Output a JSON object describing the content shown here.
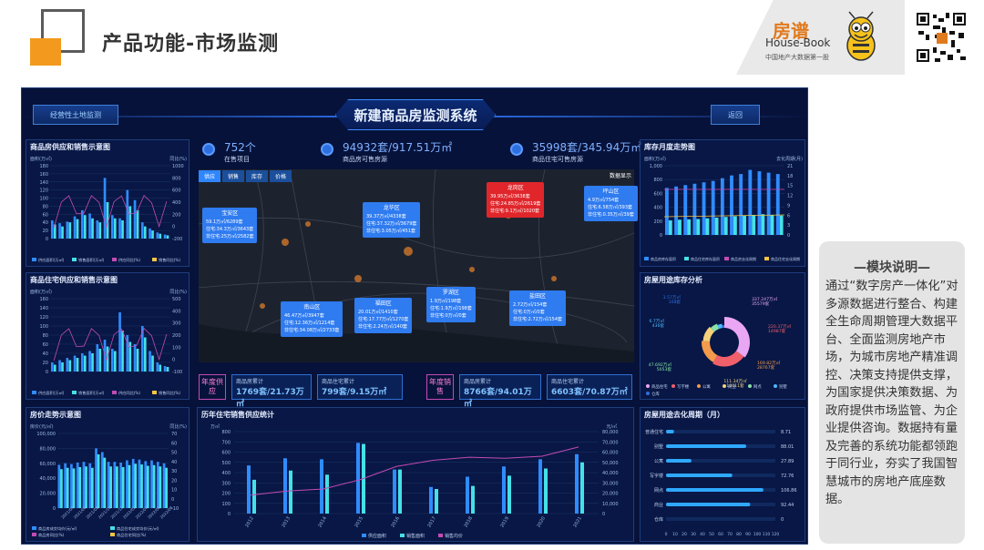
{
  "slide": {
    "title": "产品功能-市场监测"
  },
  "brand": {
    "name_cn": "房谱",
    "name_en": "House-Book",
    "tagline": "中国地产大数据第一股"
  },
  "dashboard": {
    "title": "新建商品房监测系统",
    "left_button": "经营性土地监测",
    "right_button": "返回",
    "stats": [
      {
        "value": "752个",
        "label": "在售项目"
      },
      {
        "value": "94932套/917.51万㎡",
        "label": "商品房可售房源"
      },
      {
        "value": "35998套/345.94万㎡",
        "label": "商品住宅可售房源"
      }
    ],
    "map": {
      "tabs": [
        "供应",
        "销售",
        "库存",
        "价格"
      ],
      "legend_label": "数据显示",
      "districts": [
        {
          "name": "宝安区",
          "l1": "59.1万㎡/6289套",
          "l2": "住宅:34.3万㎡/3643套",
          "l3": "非住宅:25万㎡/2582套"
        },
        {
          "name": "龙华区",
          "l1": "39.37万㎡/4338套",
          "l2": "住宅:37.32万㎡/3679套",
          "l3": "非住宅:3.05万㎡/451套"
        },
        {
          "name": "龙岗区",
          "l1": "39.95万㎡/3638套",
          "l2": "住宅:24.85万㎡/2619套",
          "l3": "非住宅:9.1万㎡/1020套"
        },
        {
          "name": "坪山区",
          "l1": "4.9万㎡/754套",
          "l2": "住宅:6.58万㎡/393套",
          "l3": "非住宅:0.35万㎡/39套"
        },
        {
          "name": "南山区",
          "l1": "46.47万㎡/3947套",
          "l2": "住宅:12.36万㎡/1214套",
          "l3": "非住宅:34.08万㎡/2733套"
        },
        {
          "name": "福田区",
          "l1": "20.01万㎡/1410套",
          "l2": "住宅:17.77万㎡/1270套",
          "l3": "非住宅:2.24万㎡/140套"
        },
        {
          "name": "罗湖区",
          "l1": "1.9万㎡/198套",
          "l2": "住宅:1.9万㎡/198套",
          "l3": "非住宅:0万㎡/0套"
        },
        {
          "name": "盐田区",
          "l1": "2.72万㎡/154套",
          "l2": "住宅:0万㎡/0套",
          "l3": "非住宅:2.72万㎡/154套"
        }
      ]
    },
    "kpis": {
      "supply_label": "年度供应",
      "sales_label": "年度销售",
      "items": [
        {
          "label": "商品房累计",
          "value": "1769套/21.73万㎡"
        },
        {
          "label": "商品住宅累计",
          "value": "799套/9.15万㎡"
        },
        {
          "label": "商品房累计",
          "value": "8766套/94.01万㎡"
        },
        {
          "label": "商品住宅累计",
          "value": "6603套/70.87万㎡"
        }
      ]
    },
    "panels": {
      "p1": "商品房供应和销售示意图",
      "p2": "商品住宅供应和销售示意图",
      "p3": "房价走势示意图",
      "p4": "历年住宅销售供应统计",
      "p5": "库存月度走势图",
      "p6": "房屋用途库存分析",
      "p7": "房屋用途去化周期（月）"
    },
    "axis_units": {
      "area_wan": "面积(万㎡)",
      "ratio": "同比(%)",
      "price": "房价(元/㎡)",
      "wan": "万㎡",
      "yuan": "元/㎡",
      "stock_area": "面积(万㎡)",
      "destock": "去化周期(月)"
    },
    "legends": {
      "p1": [
        "供应面积(万㎡)",
        "销售面积(万㎡)",
        "供应同比(%)",
        "销售同比(%)"
      ],
      "p3": [
        "商品房成交均价(元/㎡)",
        "商品住宅成交均价(元/㎡)",
        "商品房同比(%)",
        "商品住宅同比(%)"
      ],
      "p4": [
        "供应面积",
        "销售面积",
        "销售均价"
      ],
      "p5": [
        "商品房库存面积",
        "商品住宅库存面积",
        "商品房去化周期",
        "商品住宅去化周期"
      ],
      "p6": [
        "商品住宅",
        "写字楼",
        "公寓",
        "商业",
        "网点",
        "别墅",
        "仓库"
      ]
    },
    "donut_labels": [
      {
        "text": "337.247万㎡",
        "sub": "35579套"
      },
      {
        "text": "220.37万㎡",
        "sub": "14987套"
      },
      {
        "text": "169.82万㎡",
        "sub": "28767套"
      },
      {
        "text": "111.34万㎡",
        "sub": "10011套"
      },
      {
        "text": "47.692万㎡",
        "sub": "5053套"
      },
      {
        "text": "6.7万㎡",
        "sub": "436套"
      },
      {
        "text": "3.57万㎡",
        "sub": "108套"
      }
    ],
    "destock": {
      "categories": [
        "普通住宅",
        "别墅",
        "公寓",
        "写字楼",
        "网点",
        "商业",
        "仓库"
      ],
      "values": [
        8.71,
        88.01,
        27.89,
        72.76,
        106.86,
        92.44,
        0
      ]
    },
    "years": [
      "2012",
      "2013",
      "2014",
      "2015",
      "2016",
      "2017",
      "2018",
      "2019",
      "2020",
      "2021"
    ]
  },
  "note": {
    "heading": "—模块说明—",
    "body": "通过“数字房产一体化”对多源数据进行整合、构建全生命周期管理大数据平台、全面监测房地产市场，为城市房地产精准调控、决策支持提供支撑，为国家提供决策数据、为政府提供市场监管、为企业提供咨询。数据持有量及完善的系统功能都领跑于同行业，夯实了我国智慧城市的房地产底座数据。"
  },
  "chart_data": [
    {
      "type": "bar",
      "title": "历年住宅销售供应统计",
      "categories": [
        "2012",
        "2013",
        "2014",
        "2015",
        "2016",
        "2017",
        "2018",
        "2019",
        "2020",
        "2021"
      ],
      "series": [
        {
          "name": "供应面积",
          "values": [
            470,
            540,
            530,
            690,
            430,
            260,
            360,
            460,
            530,
            580
          ]
        },
        {
          "name": "销售面积",
          "values": [
            330,
            420,
            380,
            680,
            430,
            240,
            270,
            370,
            440,
            500
          ]
        },
        {
          "name": "销售均价",
          "values": [
            18000,
            22000,
            24000,
            33000,
            46000,
            52000,
            55000,
            54000,
            56000,
            65000
          ]
        }
      ],
      "ylim": [
        0,
        800
      ]
    },
    {
      "type": "bar",
      "title": "房屋用途去化周期（月）",
      "categories": [
        "普通住宅",
        "别墅",
        "公寓",
        "写字楼",
        "网点",
        "商业",
        "仓库"
      ],
      "values": [
        8.71,
        88.01,
        27.89,
        72.76,
        106.86,
        92.44,
        0
      ]
    }
  ]
}
